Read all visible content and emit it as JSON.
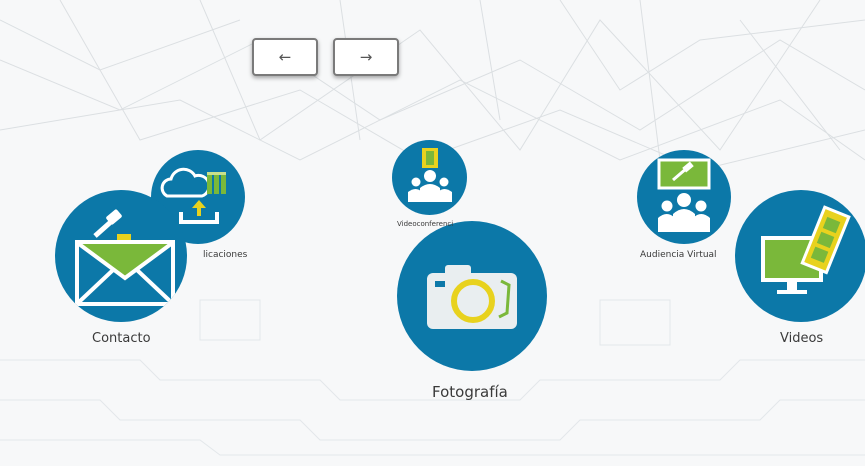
{
  "navigation": {
    "prev_label": "←",
    "next_label": "→"
  },
  "carousel": {
    "items": [
      {
        "label": "Contacto",
        "icon": "envelope-gavel-icon"
      },
      {
        "label": "Publicaciones",
        "visible_label": "licaciones",
        "icon": "cloud-upload-icon"
      },
      {
        "label": "Videoconferencia",
        "visible_label": "Videoconferenci",
        "icon": "videoconference-icon"
      },
      {
        "label": "Fotografía",
        "icon": "camera-icon"
      },
      {
        "label": "Audiencia Virtual",
        "icon": "virtual-hearing-icon"
      },
      {
        "label": "Videos",
        "icon": "monitor-film-icon"
      }
    ]
  },
  "colors": {
    "circle": "#0c78a8",
    "accent_green": "#7ab83a",
    "accent_yellow": "#e8d21e"
  }
}
